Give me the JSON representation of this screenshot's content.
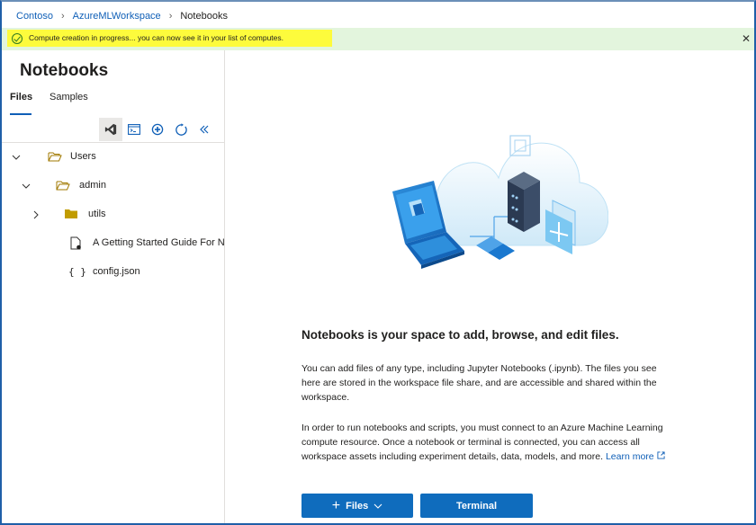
{
  "breadcrumb": {
    "items": [
      "Contoso",
      "AzureMLWorkspace",
      "Notebooks"
    ]
  },
  "banner": {
    "message": "Compute creation in progress... you can now see it in your list of computes.",
    "close": "✕"
  },
  "sidebar": {
    "title": "Notebooks",
    "tabs": [
      {
        "label": "Files",
        "active": true
      },
      {
        "label": "Samples",
        "active": false
      }
    ],
    "toolbar": [
      "vscode-icon",
      "terminal-icon",
      "add-icon",
      "refresh-icon",
      "collapse-icon"
    ],
    "tree": [
      {
        "label": "Users",
        "type": "folder",
        "expanded": true
      },
      {
        "label": "admin",
        "type": "folder",
        "expanded": true
      },
      {
        "label": "utils",
        "type": "folder",
        "expanded": false
      },
      {
        "label": "A Getting Started Guide For N",
        "type": "notebook"
      },
      {
        "label": "config.json",
        "type": "json",
        "icon_text": "{ }"
      }
    ]
  },
  "main": {
    "heading": "Notebooks is your space to add, browse, and edit files.",
    "paragraph1": "You can add files of any type, including Jupyter Notebooks (.ipynb). The files you see here are stored in the workspace file share, and are accessible and shared within the workspace.",
    "paragraph2": "In order to run notebooks and scripts, you must connect to an Azure Machine Learning compute resource. Once a notebook or terminal is connected, you can access all workspace assets including experiment details, data, models, and more.",
    "learn_more": "Learn more",
    "buttons": {
      "files": "Files",
      "terminal": "Terminal"
    }
  },
  "colors": {
    "accent": "#0f6cbd",
    "link": "#0f5fb7",
    "banner_bg": "#e3f5dd",
    "highlight": "#fdfb3c",
    "folder": "#c19c00"
  }
}
